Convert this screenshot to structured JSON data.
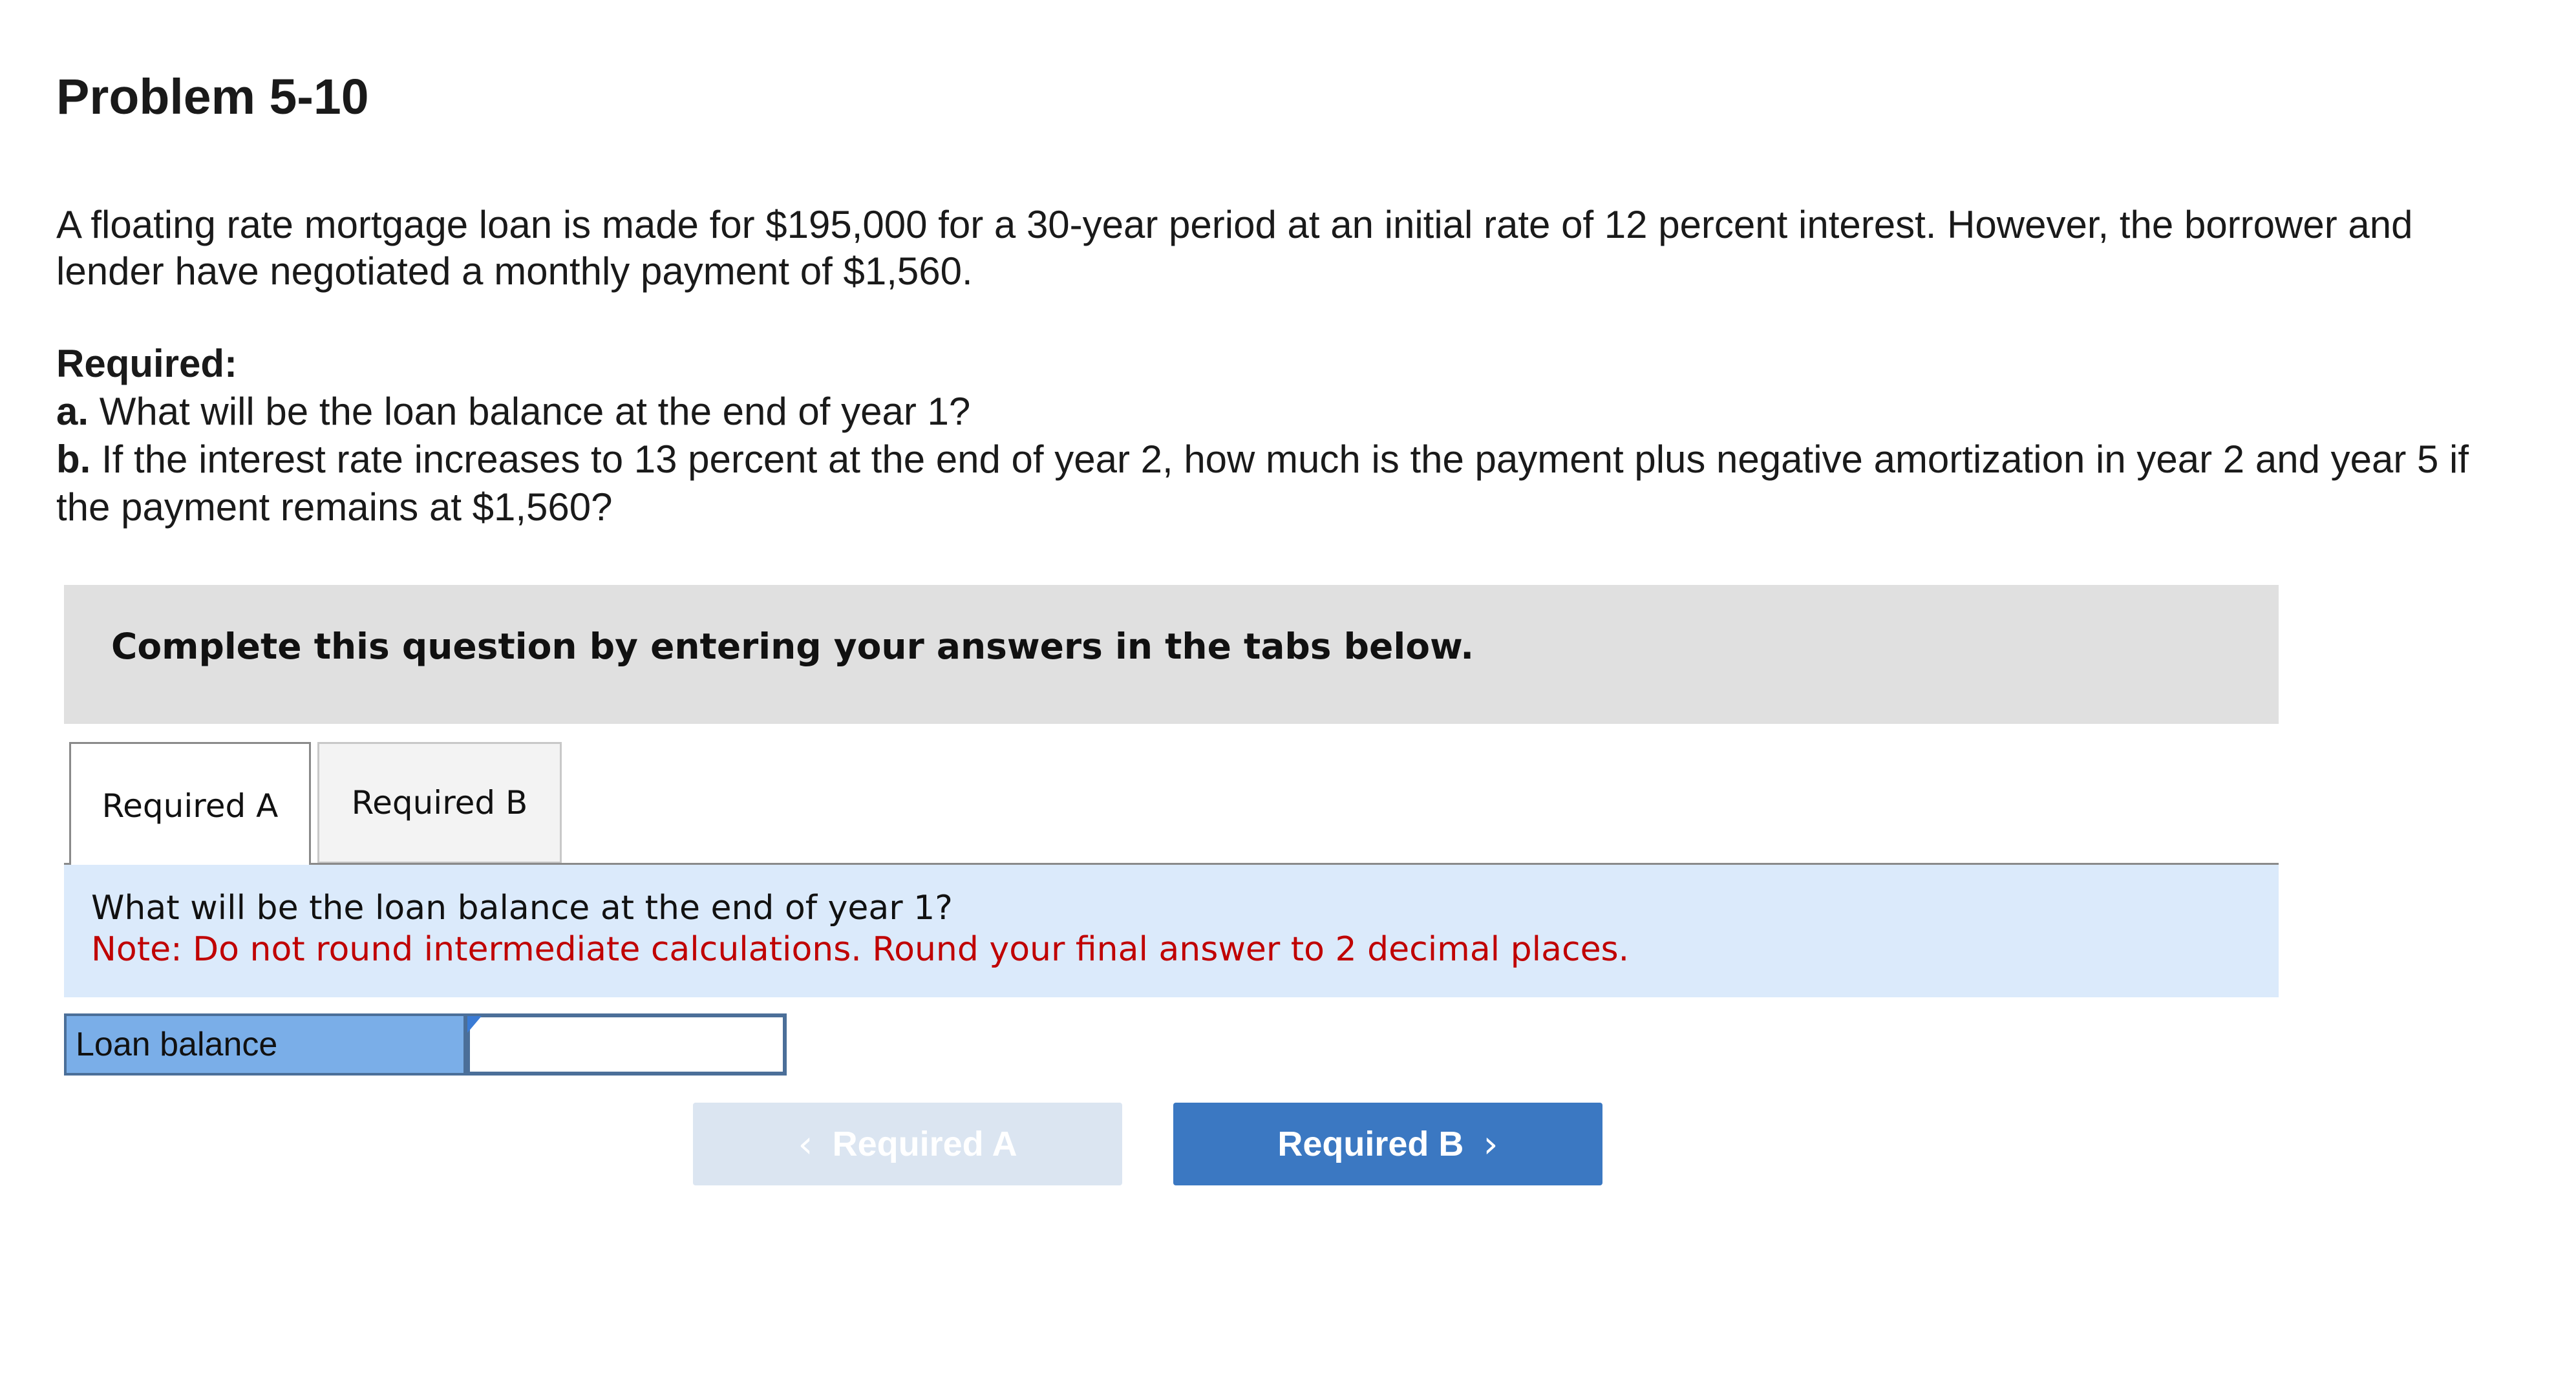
{
  "header": {
    "title": "Problem 5-10"
  },
  "problem": {
    "text": "A floating rate mortgage loan is made for $195,000 for a 30-year period at an initial rate of 12 percent interest. However, the borrower and lender have negotiated a monthly payment of $1,560."
  },
  "required": {
    "heading": "Required:",
    "items": [
      {
        "letter": "a.",
        "text": "What will be the loan balance at the end of year 1?"
      },
      {
        "letter": "b.",
        "text": "If the interest rate increases to 13 percent at the end of year 2, how much is the payment plus negative amortization in year 2 and year 5 if the payment remains at $1,560?"
      }
    ]
  },
  "instruction": {
    "text": "Complete this question by entering your answers in the tabs below."
  },
  "tabs": [
    {
      "label": "Required A",
      "active": true
    },
    {
      "label": "Required B",
      "active": false
    }
  ],
  "question_panel": {
    "question": "What will be the loan balance at the end of year 1?",
    "note": "Note: Do not round intermediate calculations. Round your final answer to 2 decimal places."
  },
  "answer": {
    "label": "Loan balance",
    "value": ""
  },
  "navigation": {
    "prev_label": "Required A",
    "next_label": "Required B",
    "prev_icon": "chevron-left-icon",
    "next_icon": "chevron-right-icon"
  },
  "colors": {
    "instruction_bg": "#e0e0e0",
    "question_bg": "#dbeafb",
    "note_red": "#c00000",
    "label_bg": "#7aaee8",
    "next_btn": "#3b78c2",
    "prev_btn_disabled": "#dbe5f1"
  }
}
